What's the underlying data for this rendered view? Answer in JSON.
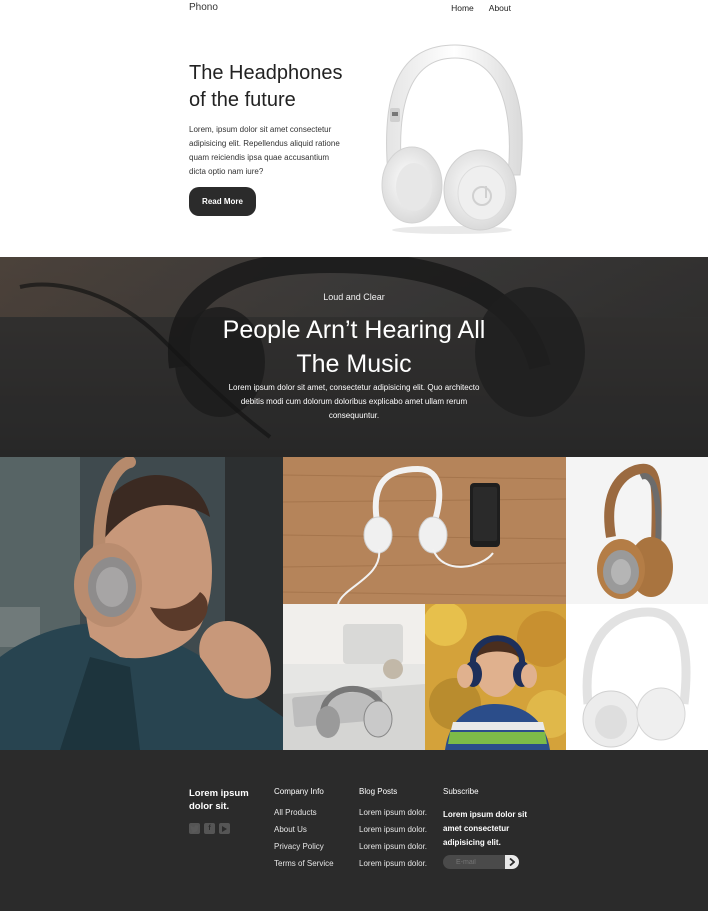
{
  "nav": {
    "brand": "Phono",
    "links": [
      "Home",
      "About"
    ]
  },
  "hero": {
    "title": "The Headphones of the future",
    "text": "Lorem, ipsum dolor sit amet consectetur adipisicing elit. Repellendus aliquid ratione quam reiciendis ipsa quae accusantium dicta optio nam iure?",
    "button": "Read More"
  },
  "banner": {
    "eyebrow": "Loud and Clear",
    "title": "People Arn’t Hearing All The Music",
    "text": "Lorem ipsum dolor sit amet, consectetur adipisicing elit. Quo architecto debitis modi cum dolorum doloribus explicabo amet ullam rerum consequuntur."
  },
  "footer": {
    "tagline": "Lorem ipsum dolor sit.",
    "social_icons": [
      "twitter-icon",
      "facebook-icon",
      "youtube-icon"
    ],
    "company": {
      "heading": "Company Info",
      "links": [
        "All Products",
        "About Us",
        "Privacy Policy",
        "Terms of Service"
      ]
    },
    "blog": {
      "heading": "Blog Posts",
      "links": [
        "Lorem ipsum dolor.",
        "Lorem ipsum dolor.",
        "Lorem ipsum dolor.",
        "Lorem ipsum dolor."
      ]
    },
    "subscribe": {
      "heading": "Subscribe",
      "text": "Lorem ipsum dolor sit amet consectetur adipisicing elit.",
      "placeholder": "E-mail"
    }
  },
  "colors": {
    "dark": "#2b2b2b",
    "banner": "#3c3c3c",
    "white": "#ffffff"
  }
}
